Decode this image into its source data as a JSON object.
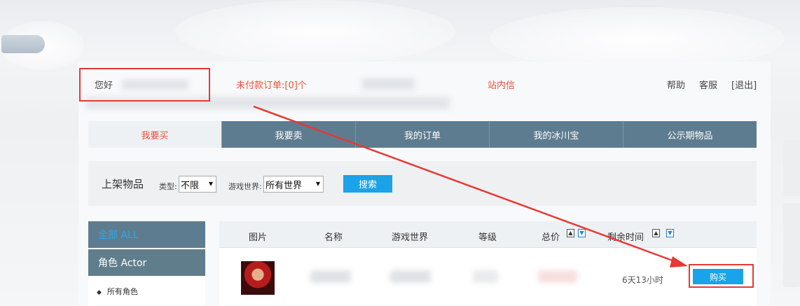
{
  "header": {
    "greeting": "您好",
    "unpaid_orders": "未付款订单:[0]个",
    "inbox": "站内信",
    "help": "帮助",
    "service": "客服",
    "logout": "[退出]"
  },
  "tabs": [
    "我要买",
    "我要卖",
    "我的订单",
    "我的冰川宝",
    "公示期物品"
  ],
  "search": {
    "title": "上架物品",
    "type_label": "类型:",
    "type_value": "不限",
    "world_label": "游戏世界:",
    "world_value": "所有世界",
    "button": "搜索"
  },
  "sidebar": {
    "all": "全部 ALL",
    "actor": "角色 Actor",
    "all_actors": "所有角色"
  },
  "table": {
    "columns": {
      "image": "图片",
      "name": "名称",
      "world": "游戏世界",
      "level": "等级",
      "price": "总价",
      "time": "剩余时间"
    },
    "rows": [
      {
        "time": "6天13小时",
        "buy": "购买"
      }
    ]
  },
  "colors": {
    "accent": "#1aa3e8",
    "nav": "#5e7c90",
    "highlight": "#e53935",
    "active_tab_text": "#e8533a"
  }
}
